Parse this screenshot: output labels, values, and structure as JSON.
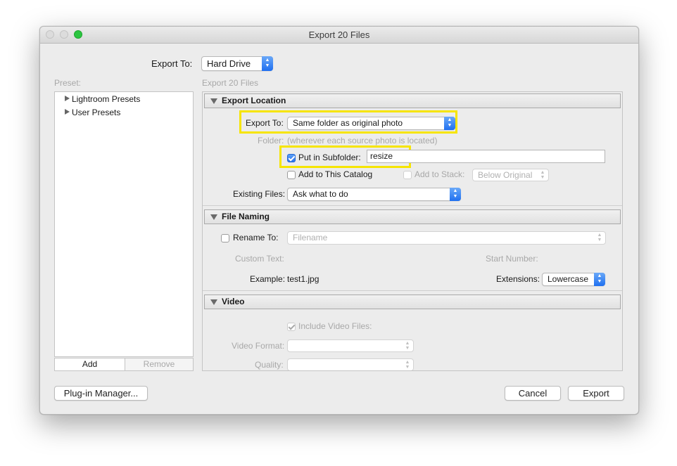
{
  "window": {
    "title": "Export 20 Files"
  },
  "export_to": {
    "label": "Export To:",
    "value": "Hard Drive"
  },
  "preset": {
    "label": "Preset:",
    "items": [
      "Lightroom Presets",
      "User Presets"
    ],
    "add": "Add",
    "remove": "Remove"
  },
  "panel_title": "Export 20 Files",
  "export_location": {
    "header": "Export Location",
    "export_to_label": "Export To:",
    "export_to_value": "Same folder as original photo",
    "folder_label": "Folder:",
    "folder_value": "(wherever each source photo is located)",
    "subfolder_label": "Put in Subfolder:",
    "subfolder_checked": true,
    "subfolder_value": "resize",
    "add_catalog_label": "Add to This Catalog",
    "add_stack_label": "Add to Stack:",
    "stack_value": "Below Original",
    "existing_label": "Existing Files:",
    "existing_value": "Ask what to do"
  },
  "file_naming": {
    "header": "File Naming",
    "rename_label": "Rename To:",
    "rename_value": "Filename",
    "custom_text_label": "Custom Text:",
    "start_number_label": "Start Number:",
    "example_label": "Example:",
    "example_value": "test1.jpg",
    "extensions_label": "Extensions:",
    "extensions_value": "Lowercase"
  },
  "video": {
    "header": "Video",
    "include_label": "Include Video Files:",
    "format_label": "Video Format:",
    "quality_label": "Quality:"
  },
  "buttons": {
    "plugin_manager": "Plug-in Manager...",
    "cancel": "Cancel",
    "export": "Export"
  },
  "colors": {
    "highlight": "#f6e500",
    "accent": "#2a74ee"
  }
}
